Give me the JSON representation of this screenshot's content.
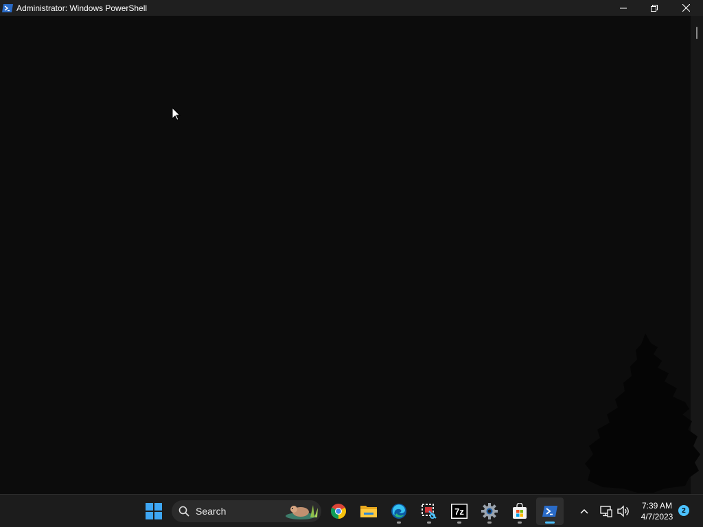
{
  "window": {
    "title": "Administrator: Windows PowerShell",
    "icon": "powershell-icon",
    "controls": [
      "minimize-icon",
      "restore-icon",
      "close-icon"
    ]
  },
  "taskbar": {
    "start_icon": "windows-start-icon",
    "search": {
      "placeholder": "Search",
      "icon": "search-icon"
    },
    "apps": [
      {
        "name": "Google Chrome",
        "icon": "chrome-icon",
        "running": false
      },
      {
        "name": "File Explorer",
        "icon": "folder-icon",
        "running": false
      },
      {
        "name": "Microsoft Edge",
        "icon": "edge-icon",
        "running": true
      },
      {
        "name": "Snipping Tool",
        "icon": "snipping-tool-icon",
        "running": true
      },
      {
        "name": "7-Zip",
        "icon": "7zip-icon",
        "label": "7z",
        "running": true
      },
      {
        "name": "Settings",
        "icon": "gear-icon",
        "running": true
      },
      {
        "name": "Microsoft Store",
        "icon": "store-icon",
        "running": true
      },
      {
        "name": "Windows PowerShell",
        "icon": "powershell-icon",
        "running": true,
        "active": true
      }
    ],
    "tray": {
      "chevron_icon": "chevron-up-icon",
      "network_icon": "network-icon",
      "volume_icon": "speaker-icon",
      "time": "7:39 AM",
      "date": "4/7/2023",
      "notification_count": "2"
    }
  },
  "colors": {
    "console_bg": "#0c0c0c",
    "titlebar_bg": "#1f1f1f",
    "taskbar_bg": "#1c1c1c",
    "accent": "#4cc2ff"
  }
}
